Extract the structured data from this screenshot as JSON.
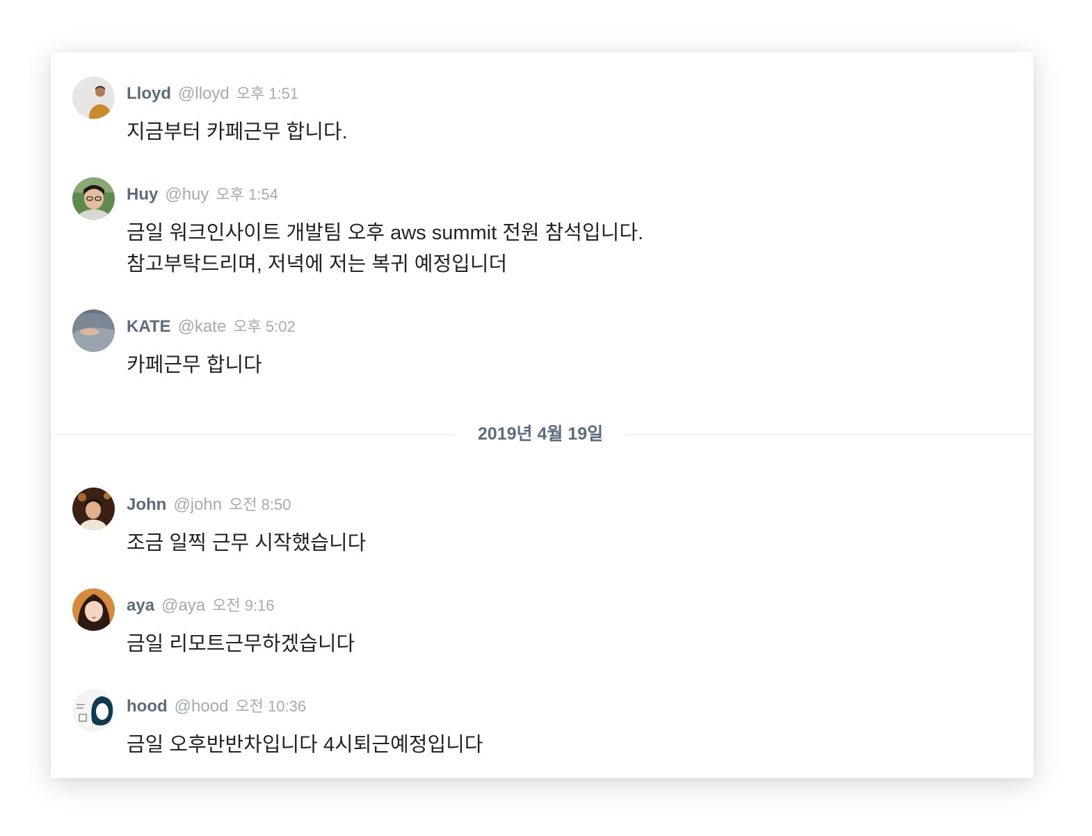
{
  "date_divider": "2019년 4월 19일",
  "messages": [
    {
      "name": "Lloyd",
      "handle": "@lloyd",
      "time": "오후 1:51",
      "text": "지금부터 카페근무 합니다."
    },
    {
      "name": "Huy",
      "handle": "@huy",
      "time": "오후 1:54",
      "text": "금일 워크인사이트 개발팀 오후 aws summit 전원 참석입니다.\n참고부탁드리며, 저녁에 저는 복귀 예정입니더"
    },
    {
      "name": "KATE",
      "handle": "@kate",
      "time": "오후 5:02",
      "text": "카페근무 합니다"
    },
    {
      "name": "John",
      "handle": "@john",
      "time": "오전 8:50",
      "text": "조금 일찍 근무 시작했습니다"
    },
    {
      "name": "aya",
      "handle": "@aya",
      "time": "오전 9:16",
      "text": "금일 리모트근무하겠습니다"
    },
    {
      "name": "hood",
      "handle": "@hood",
      "time": "오전 10:36",
      "text": "금일 오후반반차입니다 4시퇴근예정입니다"
    }
  ]
}
